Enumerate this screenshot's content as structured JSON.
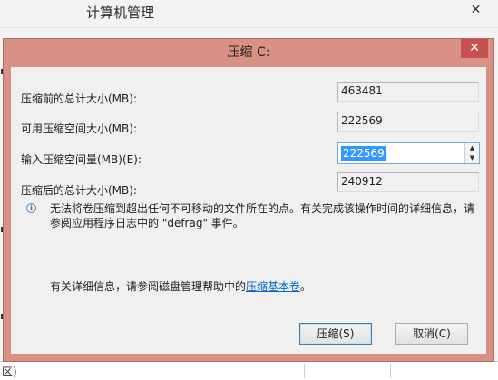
{
  "background_window": {
    "title": "计算机管理",
    "close_glyph": "✕",
    "status_fragment": "区)"
  },
  "dialog": {
    "title": "压缩 C:",
    "close_glyph": "✕",
    "fields": [
      {
        "label": "压缩前的总计大小(MB):",
        "value": "463481"
      },
      {
        "label": "可用压缩空间大小(MB):",
        "value": "222569"
      },
      {
        "label": "输入压缩空间量(MB)(E):",
        "value": "222569"
      },
      {
        "label": "压缩后的总计大小(MB):",
        "value": "240912"
      }
    ],
    "info_text": "无法将卷压缩到超出任何不可移动的文件所在的点。有关完成该操作时间的详细信息，请参阅应用程序日志中的 \"defrag\" 事件。",
    "help_prefix": "有关详细信息，请参阅磁盘管理帮助中的",
    "help_link": "压缩基本卷",
    "help_suffix": "。",
    "buttons": {
      "shrink": "压缩(S)",
      "cancel": "取消(C)"
    },
    "accent_color": "#d99185",
    "selection_color": "#3399ff"
  }
}
